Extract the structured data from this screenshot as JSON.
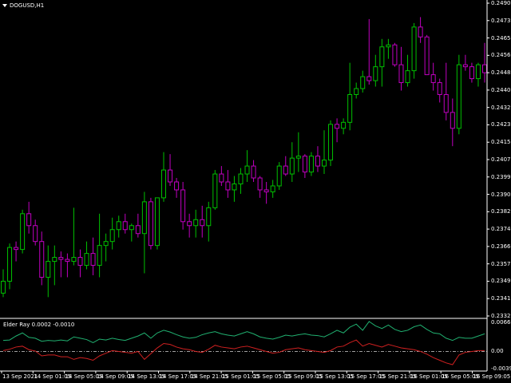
{
  "symbol": "DOGUSD,H1",
  "indicator": {
    "name": "Elder Ray",
    "values": "0.0002 -0.0010"
  },
  "price_axis": [
    "0.24900",
    "0.24735",
    "0.24650",
    "0.24565",
    "0.24485",
    "0.24400",
    "0.24320",
    "0.24235",
    "0.24155",
    "0.24070",
    "0.23990",
    "0.23905",
    "0.23825",
    "0.23740",
    "0.23660",
    "0.23575",
    "0.23495",
    "0.23410",
    "0.23325"
  ],
  "indicator_axis": [
    "0.0066",
    "0.00",
    "-0.0039"
  ],
  "time_axis": [
    "13 Sep 2021",
    "14 Sep 01:05",
    "14 Sep 05:05",
    "14 Sep 09:05",
    "14 Sep 13:05",
    "14 Sep 17:05",
    "14 Sep 21:05",
    "15 Sep 01:05",
    "15 Sep 05:05",
    "15 Sep 09:05",
    "15 Sep 13:05",
    "15 Sep 17:05",
    "15 Sep 21:05",
    "16 Sep 01:05",
    "16 Sep 05:05",
    "16 Sep 09:05"
  ],
  "colors": {
    "bull": "#00c000",
    "bear": "#c000c0",
    "bull_power": "#20b070",
    "bear_power": "#d02020",
    "axis": "#ffffff"
  },
  "candles": [
    [
      0.2344,
      0.2356,
      0.2342,
      0.235
    ],
    [
      0.235,
      0.2369,
      0.2346,
      0.2367
    ],
    [
      0.2367,
      0.237,
      0.236,
      0.2366
    ],
    [
      0.2366,
      0.2386,
      0.2364,
      0.2384
    ],
    [
      0.2384,
      0.239,
      0.2374,
      0.2378
    ],
    [
      0.2378,
      0.2381,
      0.2368,
      0.237
    ],
    [
      0.237,
      0.2375,
      0.2348,
      0.2352
    ],
    [
      0.2352,
      0.2368,
      0.2342,
      0.236
    ],
    [
      0.236,
      0.2368,
      0.2348,
      0.2362
    ],
    [
      0.2362,
      0.2365,
      0.2352,
      0.2361
    ],
    [
      0.2361,
      0.2364,
      0.2352,
      0.236
    ],
    [
      0.236,
      0.2387,
      0.2358,
      0.2362
    ],
    [
      0.2362,
      0.2366,
      0.2352,
      0.2358
    ],
    [
      0.2358,
      0.237,
      0.2356,
      0.2364
    ],
    [
      0.2364,
      0.2372,
      0.2353,
      0.2358
    ],
    [
      0.2358,
      0.2384,
      0.2352,
      0.2368
    ],
    [
      0.2368,
      0.2374,
      0.236,
      0.237
    ],
    [
      0.237,
      0.2382,
      0.2366,
      0.2376
    ],
    [
      0.2376,
      0.2383,
      0.2372,
      0.238
    ],
    [
      0.238,
      0.2384,
      0.2374,
      0.2376
    ],
    [
      0.2376,
      0.2379,
      0.237,
      0.2378
    ],
    [
      0.2378,
      0.2384,
      0.2372,
      0.2374
    ],
    [
      0.2374,
      0.2395,
      0.2354,
      0.239
    ],
    [
      0.239,
      0.2392,
      0.2366,
      0.2368
    ],
    [
      0.2368,
      0.2392,
      0.2366,
      0.2392
    ],
    [
      0.2392,
      0.2415,
      0.239,
      0.2406
    ],
    [
      0.2406,
      0.2414,
      0.2398,
      0.24
    ],
    [
      0.24,
      0.2402,
      0.2392,
      0.2396
    ],
    [
      0.2396,
      0.24,
      0.2376,
      0.238
    ],
    [
      0.238,
      0.2384,
      0.2372,
      0.2378
    ],
    [
      0.2378,
      0.2386,
      0.2372,
      0.2381
    ],
    [
      0.2381,
      0.2388,
      0.2372,
      0.2378
    ],
    [
      0.2378,
      0.239,
      0.237,
      0.2387
    ],
    [
      0.2387,
      0.2406,
      0.2386,
      0.2404
    ],
    [
      0.2404,
      0.2408,
      0.2398,
      0.24
    ],
    [
      0.24,
      0.2406,
      0.2392,
      0.2396
    ],
    [
      0.2396,
      0.2403,
      0.239,
      0.2399
    ],
    [
      0.2399,
      0.2407,
      0.2394,
      0.2404
    ],
    [
      0.2404,
      0.2416,
      0.24,
      0.2408
    ],
    [
      0.2408,
      0.2411,
      0.24,
      0.2402
    ],
    [
      0.2402,
      0.2403,
      0.2392,
      0.2396
    ],
    [
      0.2396,
      0.24,
      0.2389,
      0.2395
    ],
    [
      0.2395,
      0.2401,
      0.2392,
      0.2398
    ],
    [
      0.2398,
      0.241,
      0.2396,
      0.2408
    ],
    [
      0.2408,
      0.2413,
      0.2403,
      0.2404
    ],
    [
      0.2404,
      0.242,
      0.24,
      0.2412
    ],
    [
      0.2412,
      0.2425,
      0.2405,
      0.2413
    ],
    [
      0.2413,
      0.2414,
      0.2402,
      0.2405
    ],
    [
      0.2405,
      0.2415,
      0.2403,
      0.2413
    ],
    [
      0.2413,
      0.2418,
      0.2405,
      0.2408
    ],
    [
      0.2408,
      0.2426,
      0.2404,
      0.2411
    ],
    [
      0.2411,
      0.2431,
      0.2408,
      0.2429
    ],
    [
      0.2429,
      0.2432,
      0.242,
      0.2427
    ],
    [
      0.2427,
      0.2432,
      0.2424,
      0.243
    ],
    [
      0.243,
      0.246,
      0.2426,
      0.2444
    ],
    [
      0.2444,
      0.245,
      0.2442,
      0.2447
    ],
    [
      0.2447,
      0.2456,
      0.2445,
      0.2453
    ],
    [
      0.2453,
      0.2482,
      0.2449,
      0.2451
    ],
    [
      0.2451,
      0.2464,
      0.2448,
      0.2458
    ],
    [
      0.2458,
      0.2472,
      0.2448,
      0.2468
    ],
    [
      0.2468,
      0.2472,
      0.2462,
      0.2469
    ],
    [
      0.2469,
      0.247,
      0.2458,
      0.2459
    ],
    [
      0.2459,
      0.2468,
      0.2446,
      0.245
    ],
    [
      0.245,
      0.2464,
      0.2448,
      0.2456
    ],
    [
      0.2456,
      0.248,
      0.2452,
      0.2478
    ],
    [
      0.2478,
      0.2483,
      0.247,
      0.2473
    ],
    [
      0.2473,
      0.2474,
      0.2456,
      0.2454
    ],
    [
      0.2454,
      0.246,
      0.2446,
      0.245
    ],
    [
      0.245,
      0.2452,
      0.244,
      0.2444
    ],
    [
      0.2444,
      0.246,
      0.2431,
      0.2435
    ],
    [
      0.2435,
      0.2442,
      0.2418,
      0.2427
    ],
    [
      0.2427,
      0.2464,
      0.2424,
      0.2459
    ],
    [
      0.2459,
      0.2464,
      0.2456,
      0.2458
    ],
    [
      0.2458,
      0.246,
      0.245,
      0.2452
    ],
    [
      0.2452,
      0.246,
      0.2448,
      0.2459
    ],
    [
      0.2459,
      0.247,
      0.245,
      0.2455
    ]
  ],
  "bull_power": [
    0.0025,
    0.0026,
    0.0035,
    0.0042,
    0.0032,
    0.003,
    0.0023,
    0.0025,
    0.0024,
    0.0026,
    0.0024,
    0.0033,
    0.003,
    0.0027,
    0.002,
    0.0028,
    0.0026,
    0.003,
    0.0027,
    0.0025,
    0.003,
    0.0035,
    0.0042,
    0.003,
    0.0042,
    0.0048,
    0.0044,
    0.0038,
    0.0033,
    0.003,
    0.0032,
    0.0038,
    0.0042,
    0.0045,
    0.004,
    0.0037,
    0.0035,
    0.004,
    0.0045,
    0.004,
    0.0033,
    0.003,
    0.0028,
    0.0032,
    0.0037,
    0.0035,
    0.0038,
    0.004,
    0.0037,
    0.0036,
    0.0033,
    0.004,
    0.0048,
    0.0042,
    0.0055,
    0.0062,
    0.0048,
    0.0068,
    0.0058,
    0.0052,
    0.006,
    0.005,
    0.0045,
    0.0048,
    0.0056,
    0.006,
    0.005,
    0.0042,
    0.004,
    0.003,
    0.0025,
    0.0032,
    0.003,
    0.003,
    0.0035,
    0.004
  ],
  "bear_power": [
    0.0002,
    0.0005,
    0.001,
    0.0012,
    0.0004,
    0.0001,
    -0.001,
    -0.0008,
    -0.0008,
    -0.0012,
    -0.0012,
    -0.0018,
    -0.0014,
    -0.0016,
    -0.002,
    -0.001,
    -0.0004,
    0.0002,
    0.0,
    -0.0002,
    -0.0004,
    0.0,
    -0.0018,
    -0.0005,
    0.0008,
    0.0018,
    0.0016,
    0.001,
    0.0006,
    0.0004,
    0.0,
    -0.0002,
    0.0005,
    0.0014,
    0.001,
    0.0008,
    0.0006,
    0.001,
    0.0012,
    0.0008,
    0.0004,
    0.0,
    -0.0004,
    -0.0002,
    0.0004,
    0.0006,
    0.0008,
    0.0004,
    0.0002,
    0.0,
    -0.0002,
    0.0002,
    0.001,
    0.0012,
    0.002,
    0.0026,
    0.0012,
    0.0018,
    0.0014,
    0.001,
    0.0016,
    0.0012,
    0.0008,
    0.0006,
    0.0004,
    0.0,
    -0.0006,
    -0.0014,
    -0.002,
    -0.0026,
    -0.003,
    -0.0008,
    -0.0002,
    0.0,
    0.0002,
    0.0002
  ]
}
